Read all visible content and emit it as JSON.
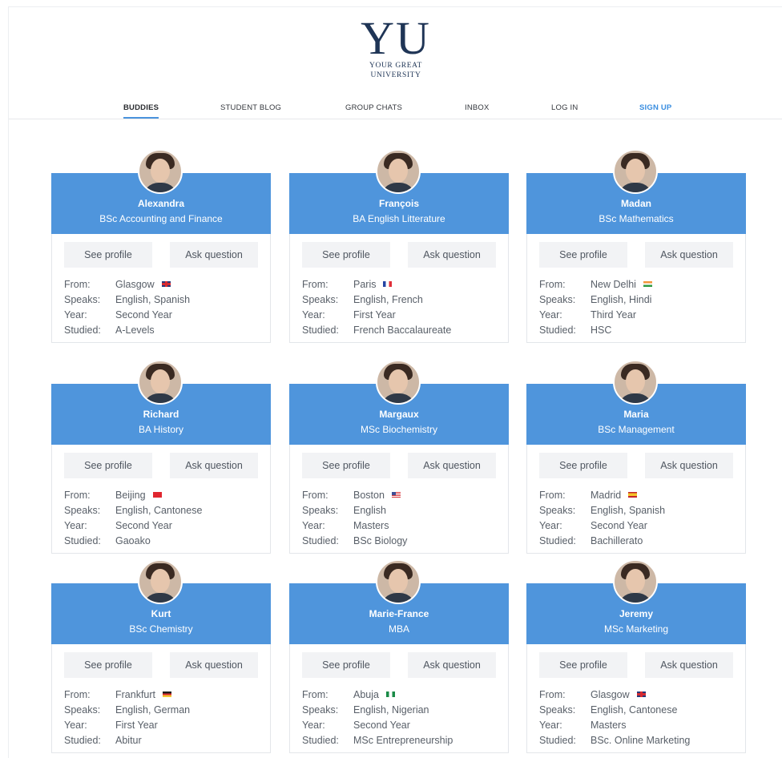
{
  "logo": {
    "mark": "YU",
    "line1": "YOUR GREAT",
    "line2": "UNIVERSITY"
  },
  "nav": [
    {
      "label": "BUDDIES",
      "active": true
    },
    {
      "label": "STUDENT  BLOG"
    },
    {
      "label": "GROUP CHATS"
    },
    {
      "label": "INBOX"
    },
    {
      "label": "LOG IN"
    },
    {
      "label": "SIGN UP",
      "accent": "#3a8ee0"
    }
  ],
  "labels": {
    "see_profile": "See profile",
    "ask_question": "Ask question",
    "from": "From:",
    "speaks": "Speaks:",
    "year": "Year:",
    "studied": "Studied:"
  },
  "colors": {
    "card_header": "#4f95dc",
    "accent": "#3a8ee0"
  },
  "buddies": [
    {
      "name": "Alexandra",
      "course": "BSc Accounting and Finance",
      "from": "Glasgow",
      "flag": "uk",
      "speaks": "English, Spanish",
      "year": "Second Year",
      "studied": "A-Levels"
    },
    {
      "name": "François",
      "course": "BA English Litterature",
      "from": "Paris",
      "flag": "fr",
      "speaks": "English, French",
      "year": "First Year",
      "studied": "French Baccalaureate"
    },
    {
      "name": "Madan",
      "course": "BSc Mathematics",
      "from": "New Delhi",
      "flag": "in",
      "speaks": "English, Hindi",
      "year": "Third Year",
      "studied": "HSC"
    },
    {
      "name": "Richard",
      "course": "BA History",
      "from": "Beijing",
      "flag": "cn",
      "speaks": "English, Cantonese",
      "year": "Second Year",
      "studied": "Gaoako"
    },
    {
      "name": "Margaux",
      "course": "MSc Biochemistry",
      "from": "Boston",
      "flag": "us",
      "speaks": "English",
      "year": "Masters",
      "studied": "BSc Biology"
    },
    {
      "name": "Maria",
      "course": "BSc Management",
      "from": "Madrid",
      "flag": "es",
      "speaks": "English, Spanish",
      "year": "Second Year",
      "studied": "Bachillerato"
    },
    {
      "name": "Kurt",
      "course": "BSc Chemistry",
      "from": "Frankfurt",
      "flag": "de",
      "speaks": "English, German",
      "year": "First Year",
      "studied": "Abitur"
    },
    {
      "name": "Marie-France",
      "course": "MBA",
      "from": "Abuja",
      "flag": "ng",
      "speaks": "English, Nigerian",
      "year": "Second Year",
      "studied": "MSc Entrepreneurship"
    },
    {
      "name": "Jeremy",
      "course": "MSc Marketing",
      "from": "Glasgow",
      "flag": "uk",
      "speaks": "English, Cantonese",
      "year": "Masters",
      "studied": "BSc. Online Marketing"
    }
  ]
}
